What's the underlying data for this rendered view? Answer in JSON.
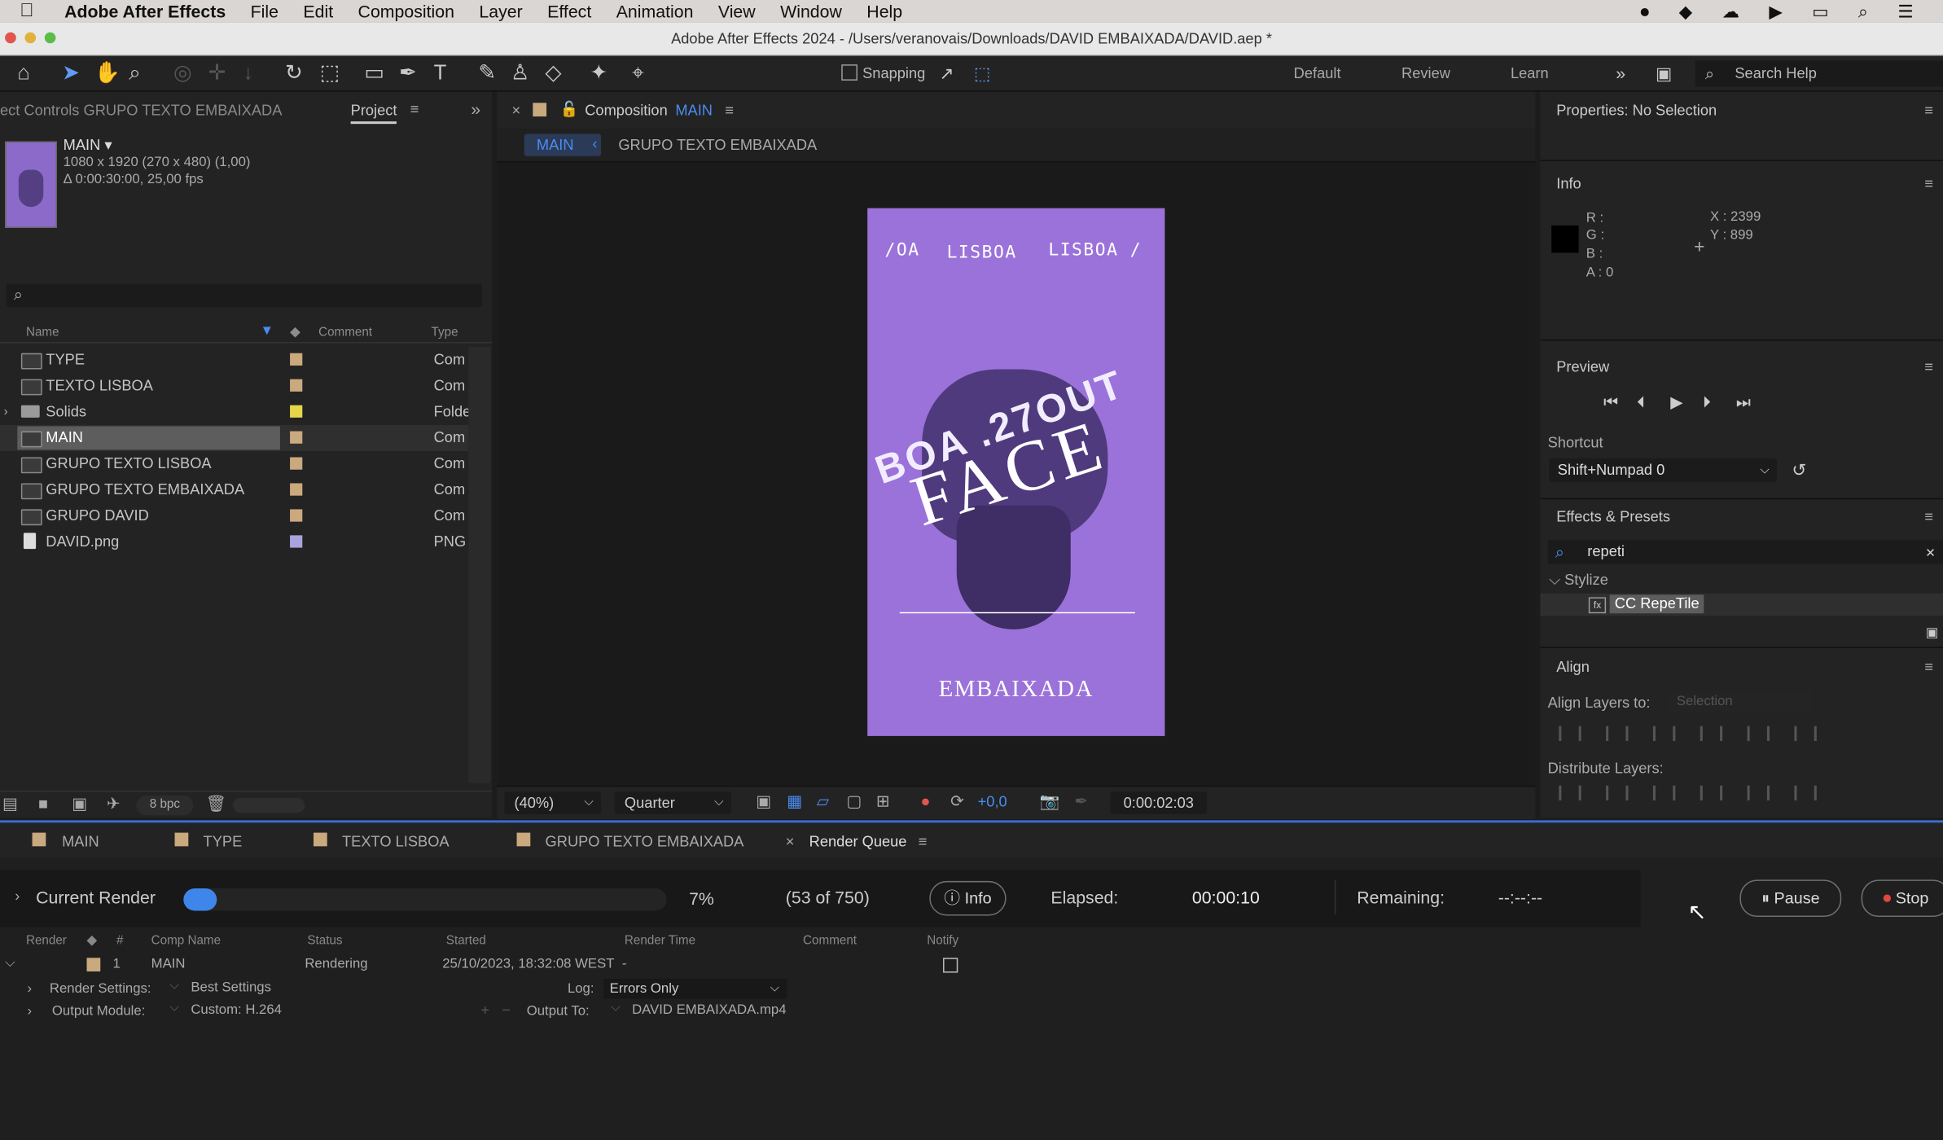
{
  "menubar": {
    "app": "Adobe After Effects",
    "items": [
      "File",
      "Edit",
      "Composition",
      "Layer",
      "Effect",
      "Animation",
      "View",
      "Window",
      "Help"
    ]
  },
  "window": {
    "title": "Adobe After Effects 2024 - /Users/veranovais/Downloads/DAVID EMBAIXADA/DAVID.aep *"
  },
  "toolbar": {
    "snapping_label": "Snapping",
    "workspaces": [
      "Default",
      "Review",
      "Learn"
    ],
    "search_placeholder": "Search Help"
  },
  "project_panel": {
    "effect_controls_tab": "ect Controls GRUPO TEXTO EMBAIXADA",
    "project_tab": "Project",
    "selected_name": "MAIN ▾",
    "selected_dims": "1080 x 1920  (270 x 480) (1,00)",
    "selected_duration": "Δ 0:00:30:00, 25,00 fps",
    "columns": {
      "name": "Name",
      "comment": "Comment",
      "type": "Type"
    },
    "items": [
      {
        "name": "TYPE",
        "type": "Com",
        "label_color": "#c9a97d"
      },
      {
        "name": "TEXTO LISBOA",
        "type": "Com",
        "label_color": "#c9a97d"
      },
      {
        "name": "Solids",
        "type": "Folde",
        "label_color": "#e6d64a"
      },
      {
        "name": "MAIN",
        "type": "Com",
        "label_color": "#c9a97d"
      },
      {
        "name": "GRUPO TEXTO LISBOA",
        "type": "Com",
        "label_color": "#c9a97d"
      },
      {
        "name": "GRUPO TEXTO EMBAIXADA",
        "type": "Com",
        "label_color": "#c9a97d"
      },
      {
        "name": "GRUPO DAVID",
        "type": "Com",
        "label_color": "#c9a97d"
      },
      {
        "name": "DAVID.png",
        "type": "PNG",
        "label_color": "#a9a4dd"
      }
    ],
    "bpc": "8 bpc"
  },
  "composition_panel": {
    "tab_label": "Composition",
    "tab_comp": "MAIN",
    "breadcrumb_active": "MAIN",
    "breadcrumb_next": "GRUPO TEXTO EMBAIXADA",
    "poster": {
      "bg_color": "#9b72d9",
      "top_left": "/OA",
      "top_mid": "LISBOA",
      "top_right": "LISBOA /",
      "date_text": "BOA .27OUT",
      "face_text": "FACE",
      "bottom_text": "EMBAIXADA"
    },
    "zoom": "(40%)",
    "resolution": "Quarter",
    "exposure": "+0,0",
    "timecode": "0:00:02:03"
  },
  "right_panel": {
    "properties_title": "Properties: No Selection",
    "info_title": "Info",
    "info_r": "R :",
    "info_g": "G :",
    "info_b": "B :",
    "info_a": "A :  0",
    "info_x": "X : 2399",
    "info_y": "Y : 899",
    "preview_title": "Preview",
    "shortcut_label": "Shortcut",
    "shortcut_value": "Shift+Numpad 0",
    "effects_title": "Effects & Presets",
    "effects_search": "repeti",
    "effects_category": "Stylize",
    "effects_item": "CC RepeTile",
    "align_title": "Align",
    "align_layers_label": "Align Layers to:",
    "align_layers_value": "Selection",
    "distribute_label": "Distribute Layers:"
  },
  "timeline_tabs": [
    "MAIN",
    "TYPE",
    "TEXTO LISBOA",
    "GRUPO TEXTO EMBAIXADA",
    "Render Queue"
  ],
  "render_queue": {
    "current_render_label": "Current Render",
    "progress": 0.07,
    "percent_text": "7%",
    "frames_text": "(53 of 750)",
    "info_button": "Info",
    "elapsed_label": "Elapsed:",
    "elapsed_value": "00:00:10",
    "remaining_label": "Remaining:",
    "remaining_value": "--:--:--",
    "pause_button": "Pause",
    "stop_button": "Stop",
    "columns": {
      "render": "Render",
      "num": "#",
      "comp_name": "Comp Name",
      "status": "Status",
      "started": "Started",
      "render_time": "Render Time",
      "comment": "Comment",
      "notify": "Notify"
    },
    "item": {
      "num": "1",
      "comp_name": "MAIN",
      "status": "Rendering",
      "started": "25/10/2023, 18:32:08 WEST",
      "render_time": "-"
    },
    "render_settings_label": "Render Settings:",
    "render_settings_value": "Best Settings",
    "log_label": "Log:",
    "log_value": "Errors Only",
    "output_module_label": "Output Module:",
    "output_module_value": "Custom: H.264",
    "output_to_label": "Output To:",
    "output_to_value": "DAVID EMBAIXADA.mp4"
  }
}
